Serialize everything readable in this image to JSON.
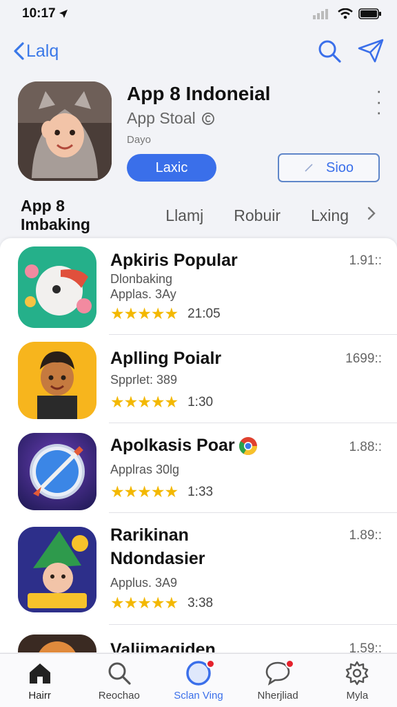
{
  "status_bar": {
    "time": "10:17"
  },
  "nav": {
    "back_label": "Lalq"
  },
  "hero": {
    "title": "App 8 Indoneial",
    "subtitle": "App Stoal",
    "detail": "Dayo",
    "primary_button": "Laxic",
    "secondary_button": "Sioo"
  },
  "tabs": [
    "App 8 Imbaking",
    "Llamj",
    "Robuir",
    "Lxing"
  ],
  "list": [
    {
      "title": "Apkiris Popular",
      "sub1": "Dlonbaking",
      "sub2": "Applas. 3Ay",
      "stars": "★★★★★",
      "rating_value": "21:05",
      "right": "1.91::"
    },
    {
      "title": "Aplling Poialr",
      "sub1": "Spprlet: 389",
      "stars": "★★★★★",
      "rating_value": "1:30",
      "right": "1699::"
    },
    {
      "title": "Apolkasis Poar",
      "sub1": "Applras 30lg",
      "stars": "★★★★★",
      "rating_value": "1:33",
      "right": "1.88::"
    },
    {
      "title": "Rarikinan",
      "title2": "Ndondasier",
      "sub1": "Applus. 3A9",
      "stars": "★★★★★",
      "rating_value": "3:38",
      "right": "1.89::"
    },
    {
      "title": "Valiimaqiden",
      "right": "1.59::"
    }
  ],
  "tab_bar": [
    {
      "label": "Hairr",
      "icon": "home-icon"
    },
    {
      "label": "Reochao",
      "icon": "search-icon"
    },
    {
      "label": "Sclan Ving",
      "icon": "compass-icon"
    },
    {
      "label": "Nherjliad",
      "icon": "chat-icon"
    },
    {
      "label": "Myla",
      "icon": "gear-icon"
    }
  ],
  "colors": {
    "accent": "#3a6fea",
    "star": "#f3b800",
    "badge": "#e5222c"
  }
}
